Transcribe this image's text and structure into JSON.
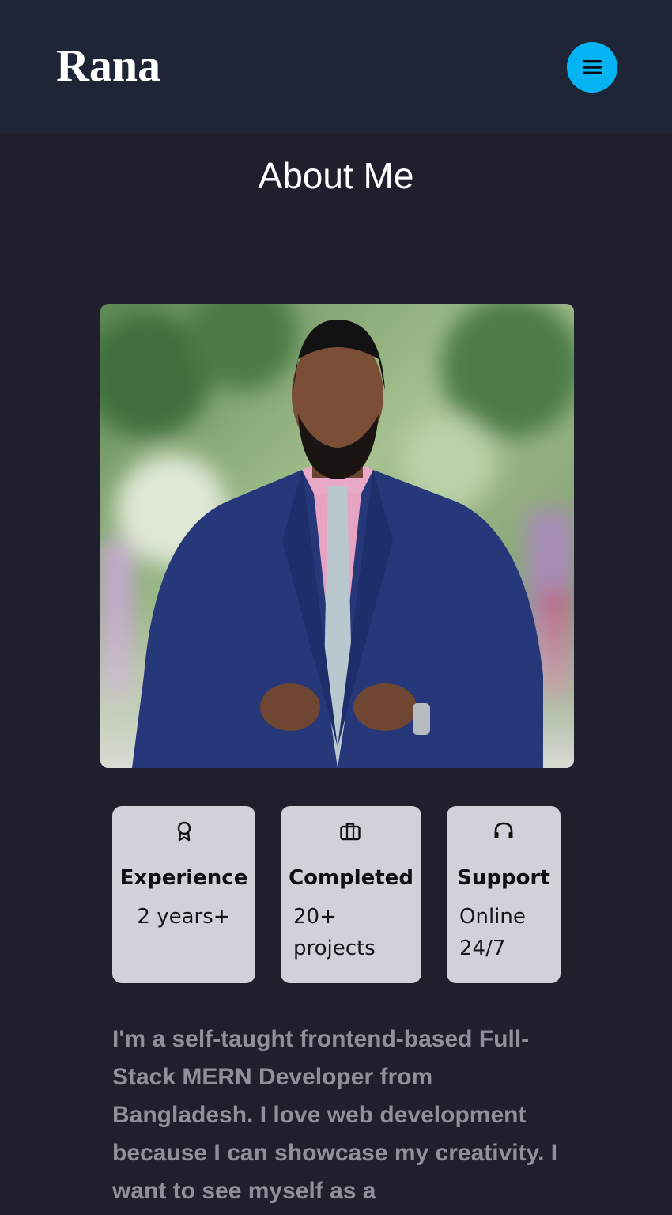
{
  "header": {
    "brand": "Rana",
    "menu_icon": "hamburger-menu-icon",
    "menu_button_color": "#04b4f2"
  },
  "about": {
    "title": "About Me",
    "photo": "portrait of a man in a navy blue suit, pink shirt and patterned tie, outdoor blurred green background",
    "cards": [
      {
        "icon": "award-icon",
        "title": "Experience",
        "value": "2 years+"
      },
      {
        "icon": "briefcase-icon",
        "title": "Completed",
        "value": "20+ projects"
      },
      {
        "icon": "headset-icon",
        "title": "Support",
        "value": "Online 24/7"
      }
    ],
    "bio": "I'm a self-taught frontend-based Full-Stack MERN Developer from Bangladesh. I love web development because I can showcase my creativity. I want to see myself as a"
  },
  "colors": {
    "background": "#1f1f2e",
    "header_background": "#1e2536",
    "card_background": "#cfd2d8",
    "bio_text": "#8e919b"
  }
}
